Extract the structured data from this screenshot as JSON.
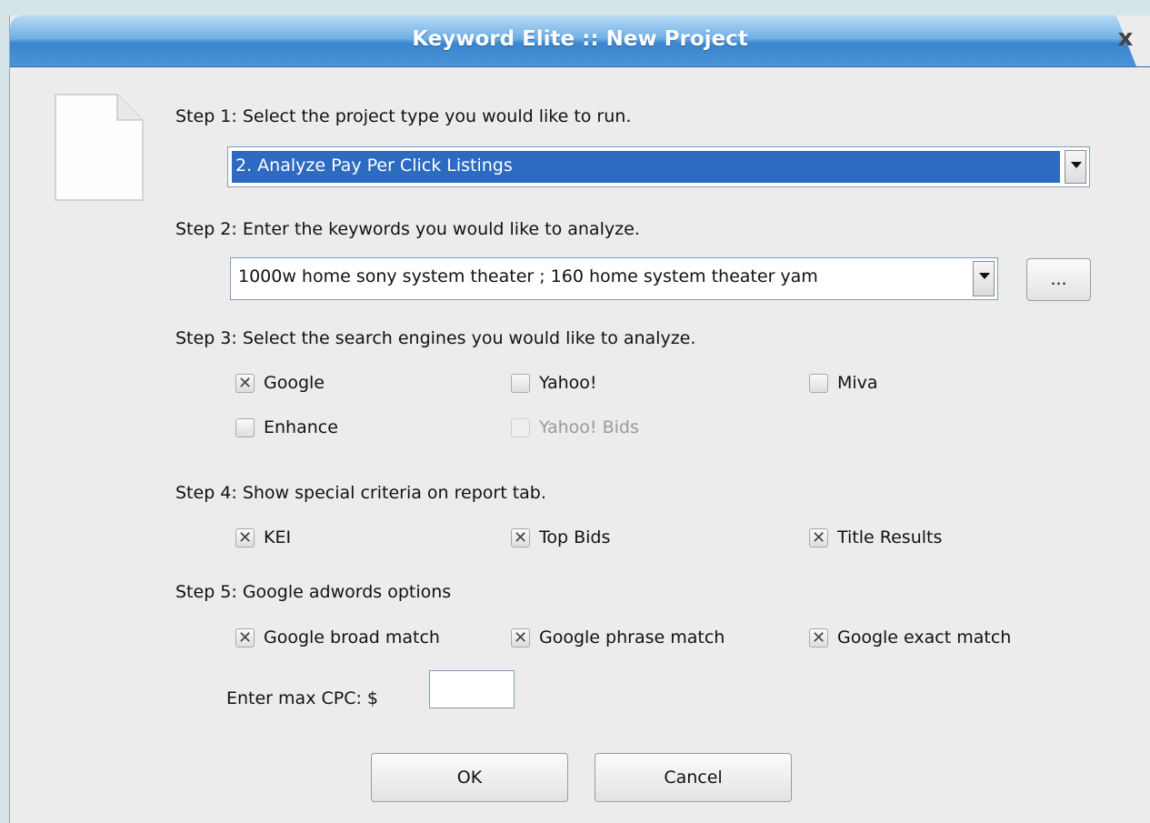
{
  "window": {
    "title": "Keyword Elite :: New Project",
    "close_glyph": "x",
    "icon": "document-icon"
  },
  "step1": {
    "label": "Step 1: Select the project type you would like to run.",
    "selected": "2. Analyze Pay Per Click Listings"
  },
  "step2": {
    "label": "Step 2: Enter the keywords you would like to analyze.",
    "keywords": "1000w home sony system theater ; 160 home system theater yam",
    "browse_label": "..."
  },
  "step3": {
    "label": "Step 3: Select the search engines you would like to analyze.",
    "engines": [
      {
        "label": "Google",
        "checked": true,
        "enabled": true
      },
      {
        "label": "Yahoo!",
        "checked": false,
        "enabled": true
      },
      {
        "label": "Miva",
        "checked": false,
        "enabled": true
      },
      {
        "label": "Enhance",
        "checked": false,
        "enabled": true
      },
      {
        "label": "Yahoo! Bids",
        "checked": false,
        "enabled": false
      }
    ]
  },
  "step4": {
    "label": "Step 4: Show special criteria on report tab.",
    "criteria": [
      {
        "label": "KEI",
        "checked": true
      },
      {
        "label": "Top Bids",
        "checked": true
      },
      {
        "label": "Title Results",
        "checked": true
      }
    ]
  },
  "step5": {
    "label": "Step 5: Google adwords options",
    "options": [
      {
        "label": "Google broad match",
        "checked": true
      },
      {
        "label": "Google phrase match",
        "checked": true
      },
      {
        "label": "Google exact match",
        "checked": true
      }
    ],
    "cpc_label": "Enter max CPC: $",
    "cpc_value": ""
  },
  "buttons": {
    "ok": "OK",
    "cancel": "Cancel"
  },
  "colors": {
    "title_bar": "#4b93d8",
    "selection": "#2d6bc2",
    "dialog_bg": "#ececec",
    "desktop": "#d5e4e6"
  }
}
